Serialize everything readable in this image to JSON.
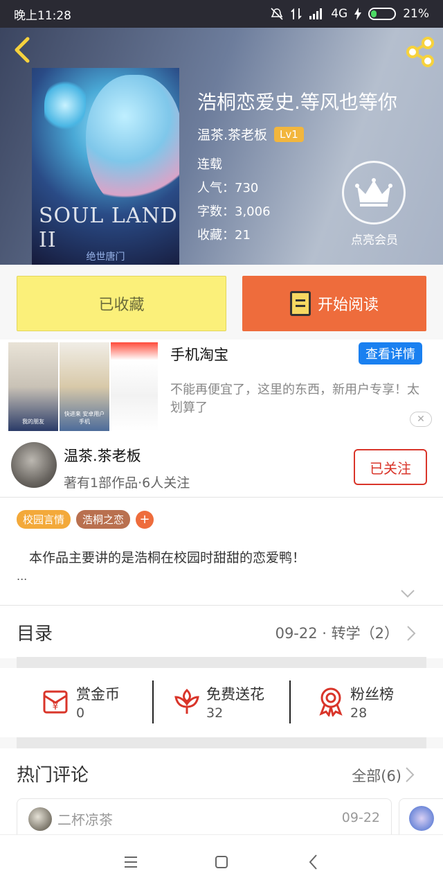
{
  "status_bar": {
    "time": "晚上11:28",
    "network": "4G",
    "battery": "21%"
  },
  "book": {
    "title": "浩桐恋爱史.等风也等你",
    "author": "温茶.茶老板",
    "level": "Lv1",
    "status": "连载",
    "popularity": "人气：730",
    "word_count": "字数：3,006",
    "favorites": "收藏：21",
    "member_label": "点亮会员",
    "cover_art_title": "SOUL LAND II",
    "cover_art_subtitle": "绝世唐门"
  },
  "actions": {
    "collected_label": "已收藏",
    "read_label": "开始阅读"
  },
  "ad": {
    "app_name": "手机淘宝",
    "detail_button": "查看详情",
    "description": "不能再便宜了，这里的东西，新用户专享！太划算了",
    "image1_caption": "我的朋友",
    "image2_caption": "快进来 安卓用户手机"
  },
  "author_block": {
    "name": "温茶.茶老板",
    "summary": "著有1部作品·6人关注",
    "follow_label": "已关注"
  },
  "tags": [
    "校园言情",
    "浩桐之恋"
  ],
  "intro": {
    "text": "本作品主要讲的是浩桐在校园时甜甜的恋爱鸭！",
    "more": "..."
  },
  "toc": {
    "title": "目录",
    "latest": "09-22 · 转学（2）"
  },
  "rewards": [
    {
      "label": "赏金币",
      "value": "0",
      "icon": "red-envelope-icon"
    },
    {
      "label": "免费送花",
      "value": "32",
      "icon": "flower-icon"
    },
    {
      "label": "粉丝榜",
      "value": "28",
      "icon": "medal-icon"
    }
  ],
  "comments": {
    "title": "热门评论",
    "all_label": "全部(6)",
    "first": {
      "user": "二杯凉茶",
      "date": "09-22"
    }
  },
  "colors": {
    "accent_orange": "#ee6c3c",
    "collected_yellow": "#fbf07a",
    "follow_red": "#d9352a",
    "ad_blue": "#1a80f0"
  }
}
